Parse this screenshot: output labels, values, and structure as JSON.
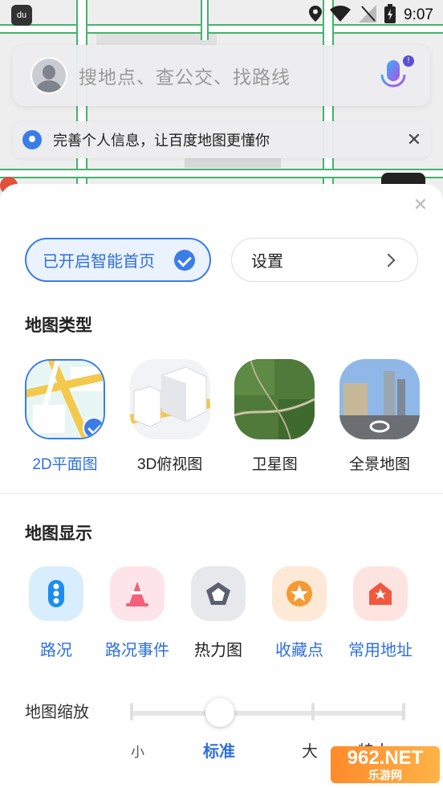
{
  "status_bar": {
    "time": "9:07"
  },
  "search": {
    "placeholder": "搜地点、查公交、找路线"
  },
  "notice": {
    "text": "完善个人信息，让百度地图更懂你"
  },
  "sheet": {
    "smart_home_label": "已开启智能首页",
    "settings_label": "设置",
    "map_type_title": "地图类型",
    "map_types": [
      {
        "label": "2D平面图",
        "selected": true
      },
      {
        "label": "3D俯视图",
        "selected": false
      },
      {
        "label": "卫星图",
        "selected": false
      },
      {
        "label": "全景地图",
        "selected": false
      }
    ],
    "map_display_title": "地图显示",
    "display_items": [
      {
        "label": "路况",
        "icon": "traffic-light-icon",
        "on": true
      },
      {
        "label": "路况事件",
        "icon": "traffic-cone-icon",
        "on": true
      },
      {
        "label": "热力图",
        "icon": "pentagon-icon",
        "on": false
      },
      {
        "label": "收藏点",
        "icon": "star-icon",
        "on": true
      },
      {
        "label": "常用地址",
        "icon": "home-icon",
        "on": true
      }
    ],
    "zoom_title": "地图缩放",
    "zoom_options": [
      "小",
      "标准",
      "大",
      "特大"
    ],
    "zoom_selected": "标准"
  },
  "watermark": {
    "brand": "962.NET",
    "sub": "乐游网"
  },
  "colors": {
    "accent": "#3a7ce8",
    "road_green": "#43b36d"
  }
}
